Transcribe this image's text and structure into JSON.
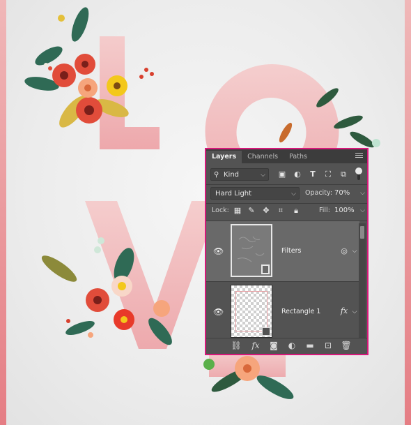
{
  "artwork": {
    "letters": [
      "L",
      "O",
      "V",
      "E"
    ]
  },
  "layers_panel": {
    "tabs": [
      {
        "label": "Layers",
        "active": true
      },
      {
        "label": "Channels",
        "active": false
      },
      {
        "label": "Paths",
        "active": false
      }
    ],
    "filter": {
      "kind_label": "Kind"
    },
    "blend_mode": "Hard Light",
    "opacity_label": "Opacity:",
    "opacity_value": "70%",
    "lock_label": "Lock:",
    "fill_label": "Fill:",
    "fill_value": "100%",
    "layers": [
      {
        "name": "Filters",
        "selected": true,
        "visible": true
      },
      {
        "name": "Rectangle 1",
        "selected": false,
        "visible": true,
        "has_fx": true
      }
    ],
    "fx_label": "fx",
    "colors": {
      "panel_bg": "#535353",
      "highlight_border": "#d6187a",
      "selected_row": "#696969"
    }
  }
}
